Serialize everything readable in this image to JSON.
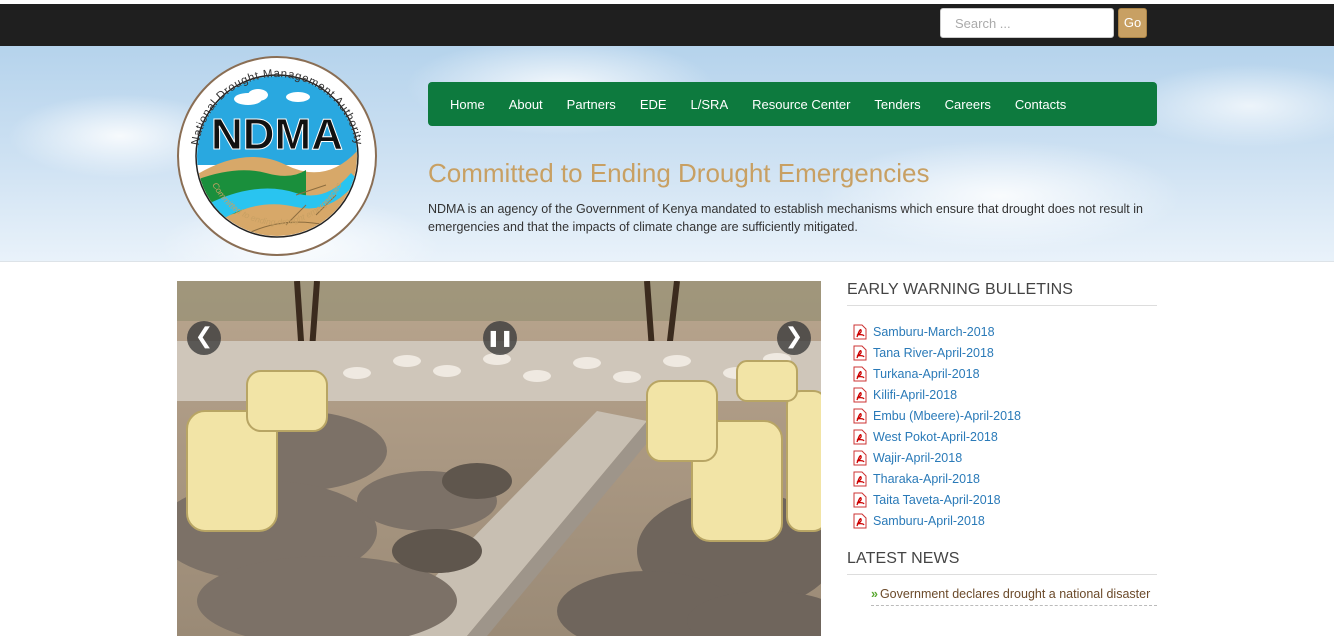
{
  "topbar": {
    "search_placeholder": "Search ...",
    "go_label": "Go"
  },
  "logo": {
    "name": "NDMA",
    "ring_text": "National Drought Management Authority",
    "motto": "Committed to ending drought emergencies"
  },
  "nav": {
    "items": [
      "Home",
      "About",
      "Partners",
      "EDE",
      "L/SRA",
      "Resource Center",
      "Tenders",
      "Careers",
      "Contacts"
    ]
  },
  "hero": {
    "tagline": "Committed to Ending Drought Emergencies",
    "intro": "NDMA is an agency of the Government of Kenya mandated to establish mechanisms which ensure that drought does not result in emergencies and that the impacts of climate change are sufficiently mitigated."
  },
  "slider": {
    "prev_icon": "chevron-left-icon",
    "pause_icon": "pause-icon",
    "next_icon": "chevron-right-icon"
  },
  "sidebar": {
    "bulletins_title": "EARLY WARNING BULLETINS",
    "bulletins": [
      "Samburu-March-2018",
      "Tana River-April-2018",
      "Turkana-April-2018",
      "Kilifi-April-2018",
      "Embu (Mbeere)-April-2018",
      "West Pokot-April-2018",
      "Wajir-April-2018",
      "Tharaka-April-2018",
      "Taita Taveta-April-2018",
      "Samburu-April-2018"
    ],
    "news_title": "LATEST NEWS",
    "news": [
      "Government declares drought a national disaster"
    ]
  },
  "colors": {
    "nav_green": "#0d7a3e",
    "tagline_gold": "#c8a063",
    "link_blue": "#2a7ab8",
    "topbar": "#1f1f1f"
  }
}
